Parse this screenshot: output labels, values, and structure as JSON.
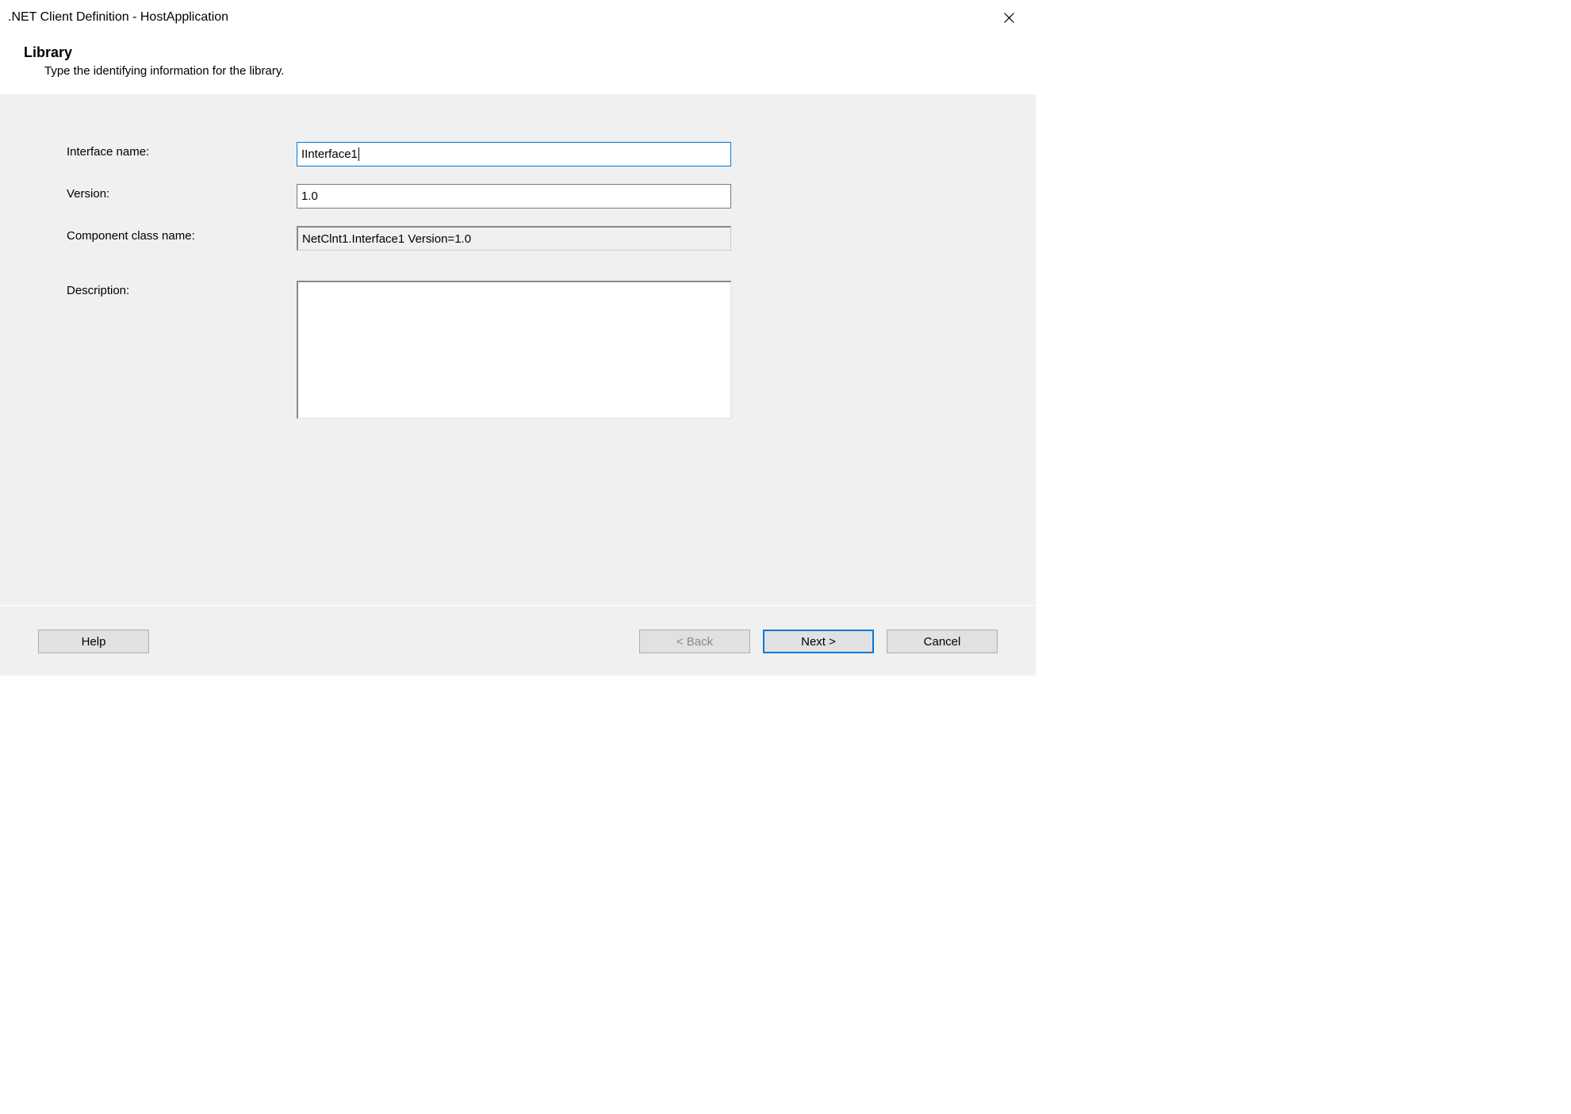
{
  "title": ".NET Client Definition - HostApplication",
  "header": {
    "title": "Library",
    "subtitle": "Type the identifying information for the library."
  },
  "form": {
    "interface_name": {
      "label": "Interface name:",
      "value": "IInterface1"
    },
    "version": {
      "label": "Version:",
      "value": "1.0"
    },
    "component_class_name": {
      "label": "Component class name:",
      "value": "NetClnt1.Interface1 Version=1.0"
    },
    "description": {
      "label": "Description:",
      "value": ""
    }
  },
  "buttons": {
    "help": "Help",
    "back": "< Back",
    "next": "Next >",
    "cancel": "Cancel"
  }
}
